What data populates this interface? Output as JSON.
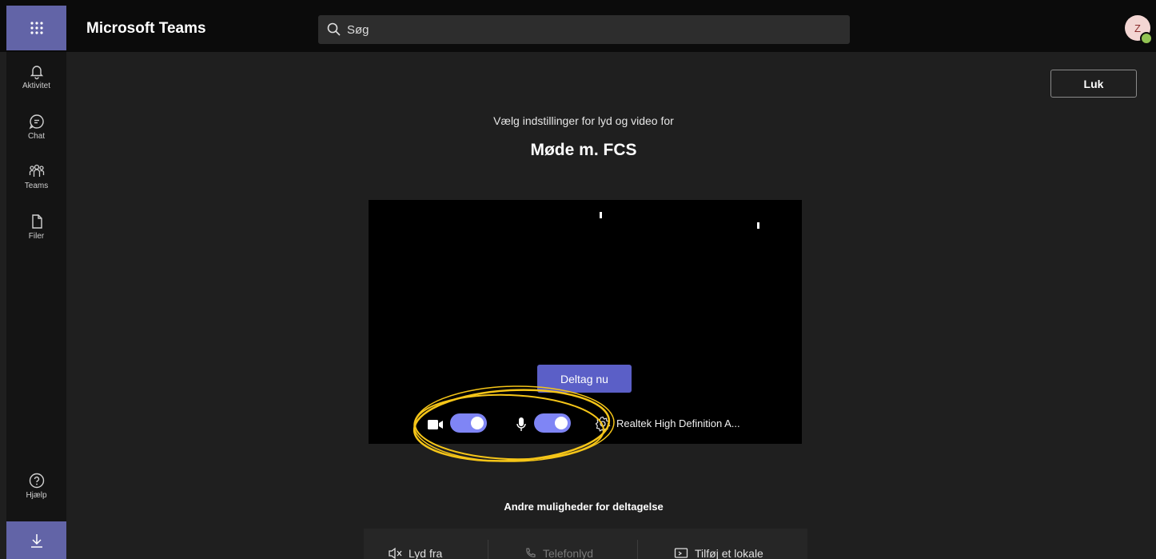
{
  "app": {
    "title": "Microsoft Teams"
  },
  "search": {
    "placeholder": "Søg"
  },
  "user": {
    "initials": "Z"
  },
  "rail": {
    "items": [
      {
        "label": "Aktivitet",
        "icon": "bell-icon"
      },
      {
        "label": "Chat",
        "icon": "chat-icon"
      },
      {
        "label": "Teams",
        "icon": "teams-icon"
      },
      {
        "label": "Filer",
        "icon": "file-icon"
      }
    ],
    "help": {
      "label": "Hjælp",
      "icon": "help-icon"
    },
    "download_icon": "download-icon"
  },
  "prejoin": {
    "close_label": "Luk",
    "subtitle": "Vælg indstillinger for lyd og video for",
    "meeting_title": "Møde m. FCS",
    "join_label": "Deltag nu",
    "camera_on": true,
    "mic_on": true,
    "audio_device": "Realtek High Definition A...",
    "other_options_title": "Andre muligheder for deltagelse",
    "options": [
      {
        "label": "Lyd fra",
        "icon": "speaker-off-icon"
      },
      {
        "label": "Telefonlyd",
        "icon": "phone-icon"
      },
      {
        "label": "Tilføj et lokale",
        "icon": "cast-icon"
      }
    ]
  },
  "colors": {
    "accent": "#6264a7",
    "toggle_on": "#7f85f5",
    "highlight": "#f5c518"
  }
}
